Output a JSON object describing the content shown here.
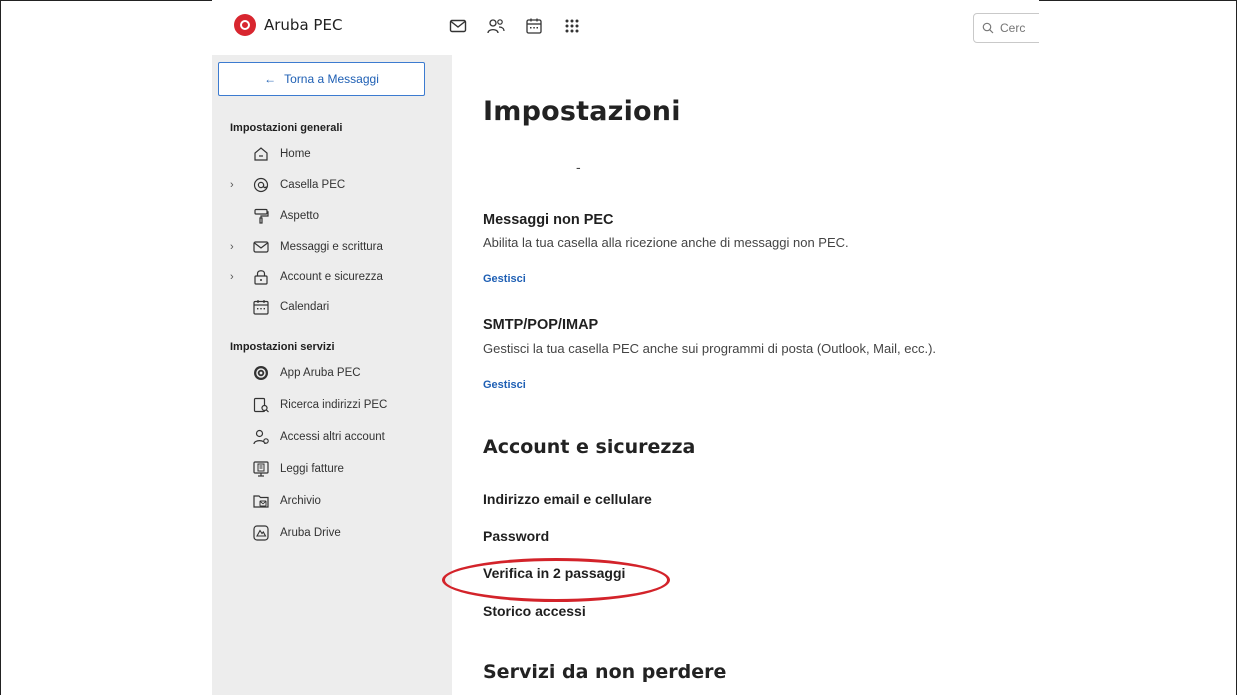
{
  "app": {
    "name": "Aruba PEC"
  },
  "search": {
    "placeholder": "Cerc"
  },
  "top_icons": [
    "mail-icon",
    "contacts-icon",
    "calendar-icon",
    "apps-grid-icon"
  ],
  "sidebar": {
    "back_label": "Torna a Messaggi",
    "general_heading": "Impostazioni generali",
    "general_items": [
      {
        "label": "Home",
        "icon": "home-icon",
        "expandable": false
      },
      {
        "label": "Casella PEC",
        "icon": "at-icon",
        "expandable": true
      },
      {
        "label": "Aspetto",
        "icon": "paint-roller-icon",
        "expandable": false
      },
      {
        "label": "Messaggi e scrittura",
        "icon": "mail-icon",
        "expandable": true
      },
      {
        "label": "Account e sicurezza",
        "icon": "lock-icon",
        "expandable": true
      },
      {
        "label": "Calendari",
        "icon": "calendar-icon",
        "expandable": false
      }
    ],
    "services_heading": "Impostazioni servizi",
    "service_items": [
      {
        "label": "App Aruba PEC",
        "icon": "aruba-app-icon"
      },
      {
        "label": "Ricerca indirizzi PEC",
        "icon": "address-search-icon"
      },
      {
        "label": "Accessi altri account",
        "icon": "users-icon"
      },
      {
        "label": "Leggi fatture",
        "icon": "invoice-icon"
      },
      {
        "label": "Archivio",
        "icon": "archive-icon"
      },
      {
        "label": "Aruba Drive",
        "icon": "drive-icon"
      }
    ]
  },
  "main": {
    "title": "Impostazioni",
    "dot": "-",
    "sections": {
      "non_pec": {
        "title": "Messaggi non PEC",
        "desc": "Abilita la tua casella alla ricezione anche di messaggi non PEC.",
        "link": "Gestisci"
      },
      "smtp": {
        "title": "SMTP/POP/IMAP",
        "desc": "Gestisci la tua casella PEC anche sui programmi di posta (Outlook, Mail, ecc.).",
        "link": "Gestisci"
      }
    },
    "account_heading": "Account e sicurezza",
    "account_items": [
      "Indirizzo email e cellulare",
      "Password",
      "Verifica in 2 passaggi",
      "Storico accessi"
    ],
    "services_heading": "Servizi da non perdere"
  },
  "colors": {
    "accent": "#1e5fb4",
    "highlight": "#d3232a",
    "sidebar_bg": "#ededed",
    "brand_red": "#d8262f"
  }
}
